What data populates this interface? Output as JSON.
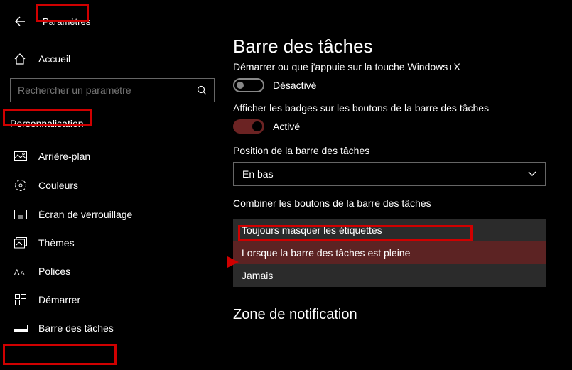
{
  "header": {
    "title": "Paramètres"
  },
  "home": {
    "label": "Accueil"
  },
  "search": {
    "placeholder": "Rechercher un paramètre"
  },
  "category": "Personnalisation",
  "nav": [
    {
      "label": "Arrière-plan"
    },
    {
      "label": "Couleurs"
    },
    {
      "label": "Écran de verrouillage"
    },
    {
      "label": "Thèmes"
    },
    {
      "label": "Polices"
    },
    {
      "label": "Démarrer"
    },
    {
      "label": "Barre des tâches"
    }
  ],
  "page": {
    "title": "Barre des tâches",
    "truncated": "Démarrer ou que j'appuie sur la touche Windows+X",
    "toggle1": {
      "state": "Désactivé"
    },
    "badges": {
      "label": "Afficher les badges sur les boutons de la barre des tâches",
      "state": "Activé"
    },
    "position": {
      "label": "Position de la barre des tâches",
      "value": "En bas"
    },
    "combine": {
      "label": "Combiner les boutons de la barre des tâches",
      "options": [
        "Toujours masquer les étiquettes",
        "Lorsque la barre des tâches est pleine",
        "Jamais"
      ]
    },
    "notification": {
      "title": "Zone de notification"
    }
  }
}
